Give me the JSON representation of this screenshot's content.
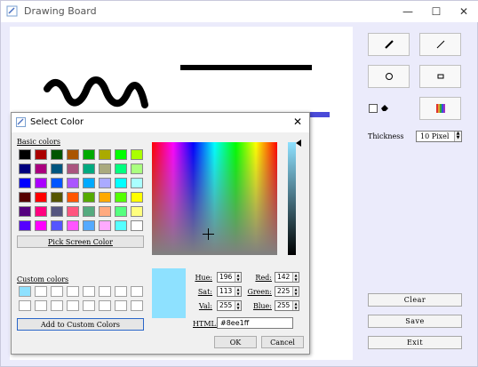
{
  "window": {
    "title": "Drawing Board"
  },
  "tools": {
    "thickness_label": "Thickness",
    "thickness_value": "10 Pixel",
    "clear_label": "Clear",
    "save_label": "Save",
    "exit_label": "Exit"
  },
  "dialog": {
    "title": "Select Color",
    "basic_colors_label": "Basic colors",
    "basic_colors": [
      [
        "#000000",
        "#aa0000",
        "#005500",
        "#aa5500",
        "#00aa00",
        "#aaaa00",
        "#00ff00",
        "#aaff00"
      ],
      [
        "#00007f",
        "#aa007f",
        "#00557f",
        "#aa557f",
        "#00aa7f",
        "#aaaa7f",
        "#00ff7f",
        "#aaff7f"
      ],
      [
        "#0000ff",
        "#aa00ff",
        "#0055ff",
        "#aa55ff",
        "#00aaff",
        "#aaaaff",
        "#00ffff",
        "#aaffff"
      ],
      [
        "#550000",
        "#ff0000",
        "#555500",
        "#ff5500",
        "#55aa00",
        "#ffaa00",
        "#55ff00",
        "#ffff00"
      ],
      [
        "#55007f",
        "#ff007f",
        "#55557f",
        "#ff557f",
        "#55aa7f",
        "#ffaa7f",
        "#55ff7f",
        "#ffff7f"
      ],
      [
        "#5500ff",
        "#ff00ff",
        "#5555ff",
        "#ff55ff",
        "#55aaff",
        "#ffaaff",
        "#55ffff",
        "#ffffff"
      ]
    ],
    "pick_screen_color_label": "Pick Screen Color",
    "custom_colors_label": "Custom colors",
    "custom_colors": [
      "#8ee1ff",
      "#ffffff",
      "#ffffff",
      "#ffffff",
      "#ffffff",
      "#ffffff",
      "#ffffff",
      "#ffffff",
      "#ffffff",
      "#ffffff",
      "#ffffff",
      "#ffffff",
      "#ffffff",
      "#ffffff",
      "#ffffff",
      "#ffffff"
    ],
    "add_custom_label": "Add to Custom Colors",
    "fields": {
      "hue_label": "Hue:",
      "hue": "196",
      "sat_label": "Sat:",
      "sat": "113",
      "val_label": "Val:",
      "val": "255",
      "red_label": "Red:",
      "red": "142",
      "green_label": "Green:",
      "green": "225",
      "blue_label": "Blue:",
      "blue": "255",
      "html_label": "HTML:",
      "html": "#8ee1ff"
    },
    "ok_label": "OK",
    "cancel_label": "Cancel",
    "current_color": "#8ee1ff"
  }
}
